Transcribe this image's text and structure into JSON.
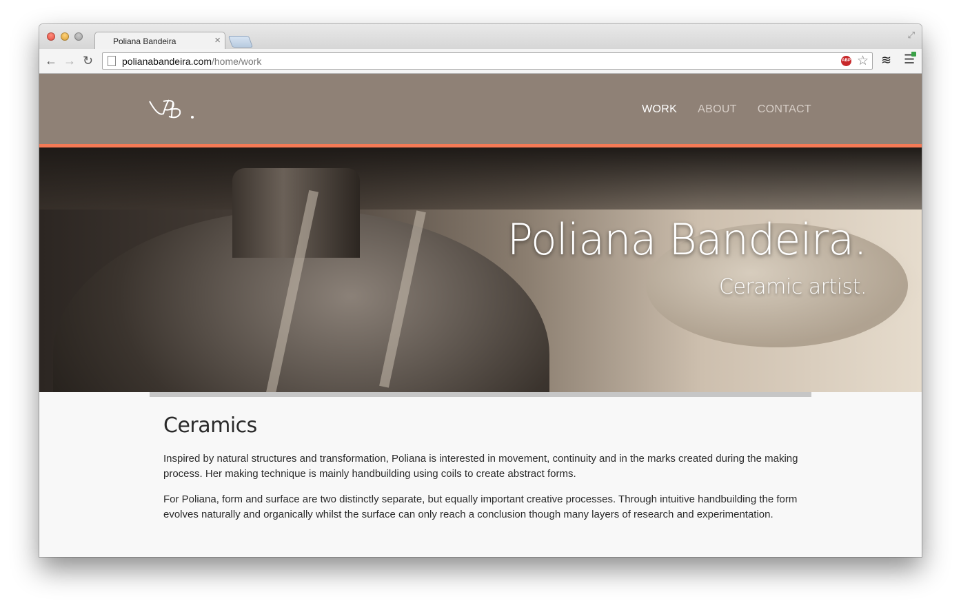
{
  "browser": {
    "tab_title": "Poliana Bandeira",
    "tab_close": "×",
    "url_host": "polianabandeira.com",
    "url_path": "/home/work",
    "abp_label": "ABP"
  },
  "site": {
    "logo_text": "PB.",
    "nav": [
      {
        "label": "WORK",
        "active": true
      },
      {
        "label": "ABOUT",
        "active": false
      },
      {
        "label": "CONTACT",
        "active": false
      }
    ],
    "hero": {
      "title": "Poliana Bandeira.",
      "subtitle": "Ceramic artist."
    },
    "section": {
      "heading": "Ceramics",
      "paragraphs": [
        "Inspired by natural structures and transformation, Poliana is interested in movement, continuity and in the marks created during the making process. Her making technique is mainly handbuilding using coils to create abstract forms.",
        "For Poliana, form and surface are two distinctly separate, but equally important creative processes. Through intuitive handbuilding the form evolves naturally and organically whilst the surface can only reach a conclusion though many layers of research and experimentation."
      ]
    }
  },
  "colors": {
    "header_bg": "#8f8176",
    "accent_rule": "#f47a56",
    "content_bg": "#f8f8f8"
  }
}
